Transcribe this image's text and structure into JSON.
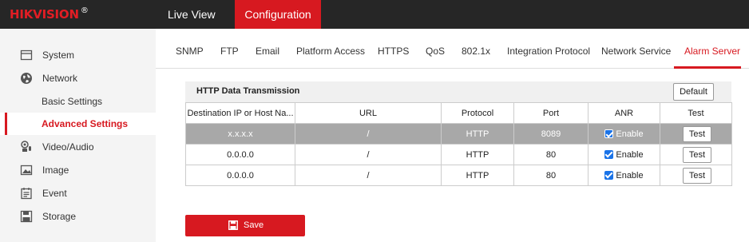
{
  "header": {
    "logo_text": "HIKVISION",
    "logo_mark": "®",
    "nav": [
      "Live View",
      "Configuration"
    ],
    "active_nav": "Configuration"
  },
  "sidebar": {
    "items": [
      {
        "label": "System",
        "icon": "system-icon"
      },
      {
        "label": "Network",
        "icon": "network-icon"
      },
      {
        "label": "Basic Settings"
      },
      {
        "label": "Advanced Settings",
        "active": true
      },
      {
        "label": "Video/Audio",
        "icon": "video-audio-icon"
      },
      {
        "label": "Image",
        "icon": "image-icon"
      },
      {
        "label": "Event",
        "icon": "event-icon"
      },
      {
        "label": "Storage",
        "icon": "storage-icon"
      }
    ]
  },
  "tabs": [
    "SNMP",
    "FTP",
    "Email",
    "Platform Access",
    "HTTPS",
    "QoS",
    "802.1x",
    "Integration Protocol",
    "Network Service",
    "Alarm Server"
  ],
  "active_tab": "Alarm Server",
  "section": {
    "title": "HTTP Data Transmission",
    "default_label": "Default"
  },
  "table": {
    "columns": [
      "Destination IP or Host Na...",
      "URL",
      "Protocol",
      "Port",
      "ANR",
      "Test"
    ],
    "rows": [
      {
        "dest": "x.x.x.x",
        "url": "/",
        "protocol": "HTTP",
        "port": "8089",
        "anr_label": "Enable",
        "anr_checked": true,
        "test_label": "Test",
        "selected": true
      },
      {
        "dest": "0.0.0.0",
        "url": "/",
        "protocol": "HTTP",
        "port": "80",
        "anr_label": "Enable",
        "anr_checked": true,
        "test_label": "Test",
        "selected": false
      },
      {
        "dest": "0.0.0.0",
        "url": "/",
        "protocol": "HTTP",
        "port": "80",
        "anr_label": "Enable",
        "anr_checked": true,
        "test_label": "Test",
        "selected": false
      }
    ]
  },
  "save_label": "Save",
  "colors": {
    "accent": "#d71920",
    "topbar": "#262626",
    "selected_row": "#a8a8a8",
    "checkbox": "#1a73e8"
  }
}
